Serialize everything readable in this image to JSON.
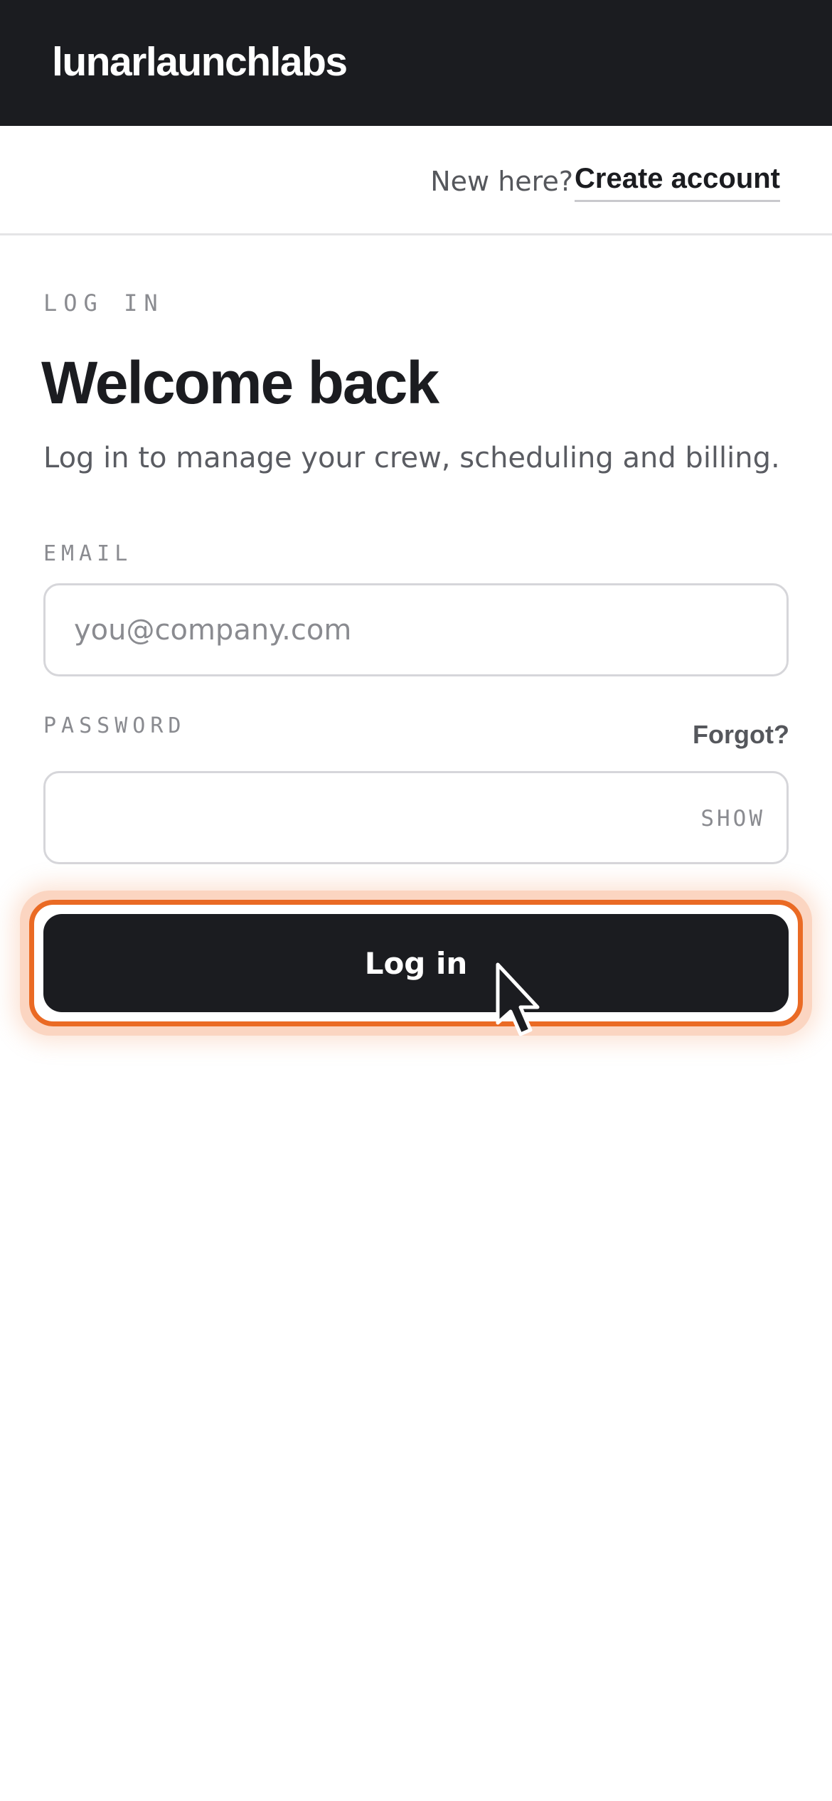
{
  "header": {
    "brand": "lunarlaunchlabs"
  },
  "account_bar": {
    "prompt": "New here?",
    "create_link": "Create account"
  },
  "form": {
    "eyebrow": "LOG IN",
    "title": "Welcome back",
    "subtitle": "Log in to manage your crew, scheduling and billing.",
    "email": {
      "label": "EMAIL",
      "placeholder": "you@company.com",
      "value": ""
    },
    "password": {
      "label": "PASSWORD",
      "forgot_label": "Forgot?",
      "toggle_label": "SHOW",
      "value": ""
    },
    "submit_label": "Log in"
  },
  "colors": {
    "header_bg": "#1b1c20",
    "button_bg": "#1b1c20",
    "focus_ring": "#ea6a24",
    "focus_glow": "#fbd5c1"
  },
  "icons": {
    "pointer": "mouse-pointer-icon"
  }
}
